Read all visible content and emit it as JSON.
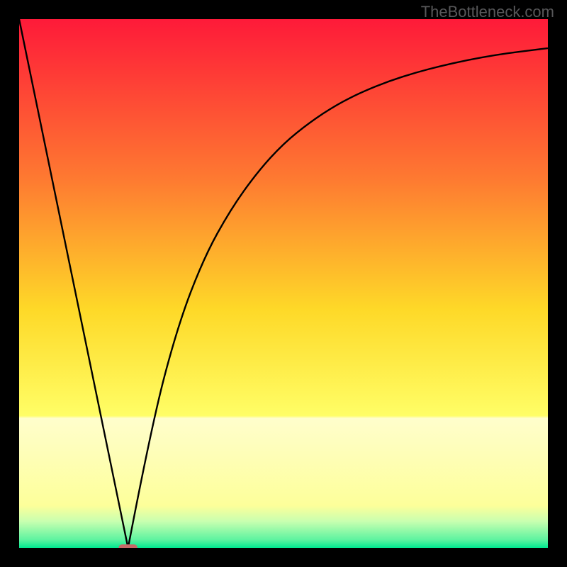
{
  "watermark": "TheBottleneck.com",
  "colors": {
    "top": "#fe1a39",
    "mid_upper": "#fe9230",
    "mid": "#fee126",
    "mid_lower": "#fffe8a",
    "near_bottom": "#e0ffa8",
    "bottom": "#00e990",
    "curve": "#000000",
    "marker": "#c86868",
    "frame": "#000000"
  },
  "chart_data": {
    "type": "line",
    "title": "",
    "xlabel": "",
    "ylabel": "",
    "xlim": [
      0,
      100
    ],
    "ylim": [
      0,
      100
    ],
    "series": [
      {
        "name": "left-slope",
        "x": [
          0,
          20.6
        ],
        "values": [
          100,
          0
        ]
      },
      {
        "name": "right-curve",
        "x": [
          20.6,
          25,
          30,
          35,
          40,
          45,
          50,
          55,
          60,
          65,
          70,
          75,
          80,
          85,
          90,
          95,
          100
        ],
        "values": [
          0,
          23,
          42,
          55,
          64,
          71,
          76.5,
          80.5,
          83.8,
          86.3,
          88.3,
          89.9,
          91.2,
          92.3,
          93.2,
          93.9,
          94.5
        ]
      }
    ],
    "marker": {
      "x": 20.6,
      "y": 0,
      "width_frac": 0.036,
      "height_frac": 0.013
    },
    "gradient_stops": [
      {
        "offset": 0.0,
        "color": "#fe1a39"
      },
      {
        "offset": 0.3,
        "color": "#fe7931"
      },
      {
        "offset": 0.55,
        "color": "#fed928"
      },
      {
        "offset": 0.75,
        "color": "#fffe66"
      },
      {
        "offset": 0.755,
        "color": "#fffecc"
      },
      {
        "offset": 0.92,
        "color": "#fdff9a"
      },
      {
        "offset": 0.95,
        "color": "#c8ffb0"
      },
      {
        "offset": 0.985,
        "color": "#5cf3a0"
      },
      {
        "offset": 1.0,
        "color": "#00e990"
      }
    ]
  }
}
